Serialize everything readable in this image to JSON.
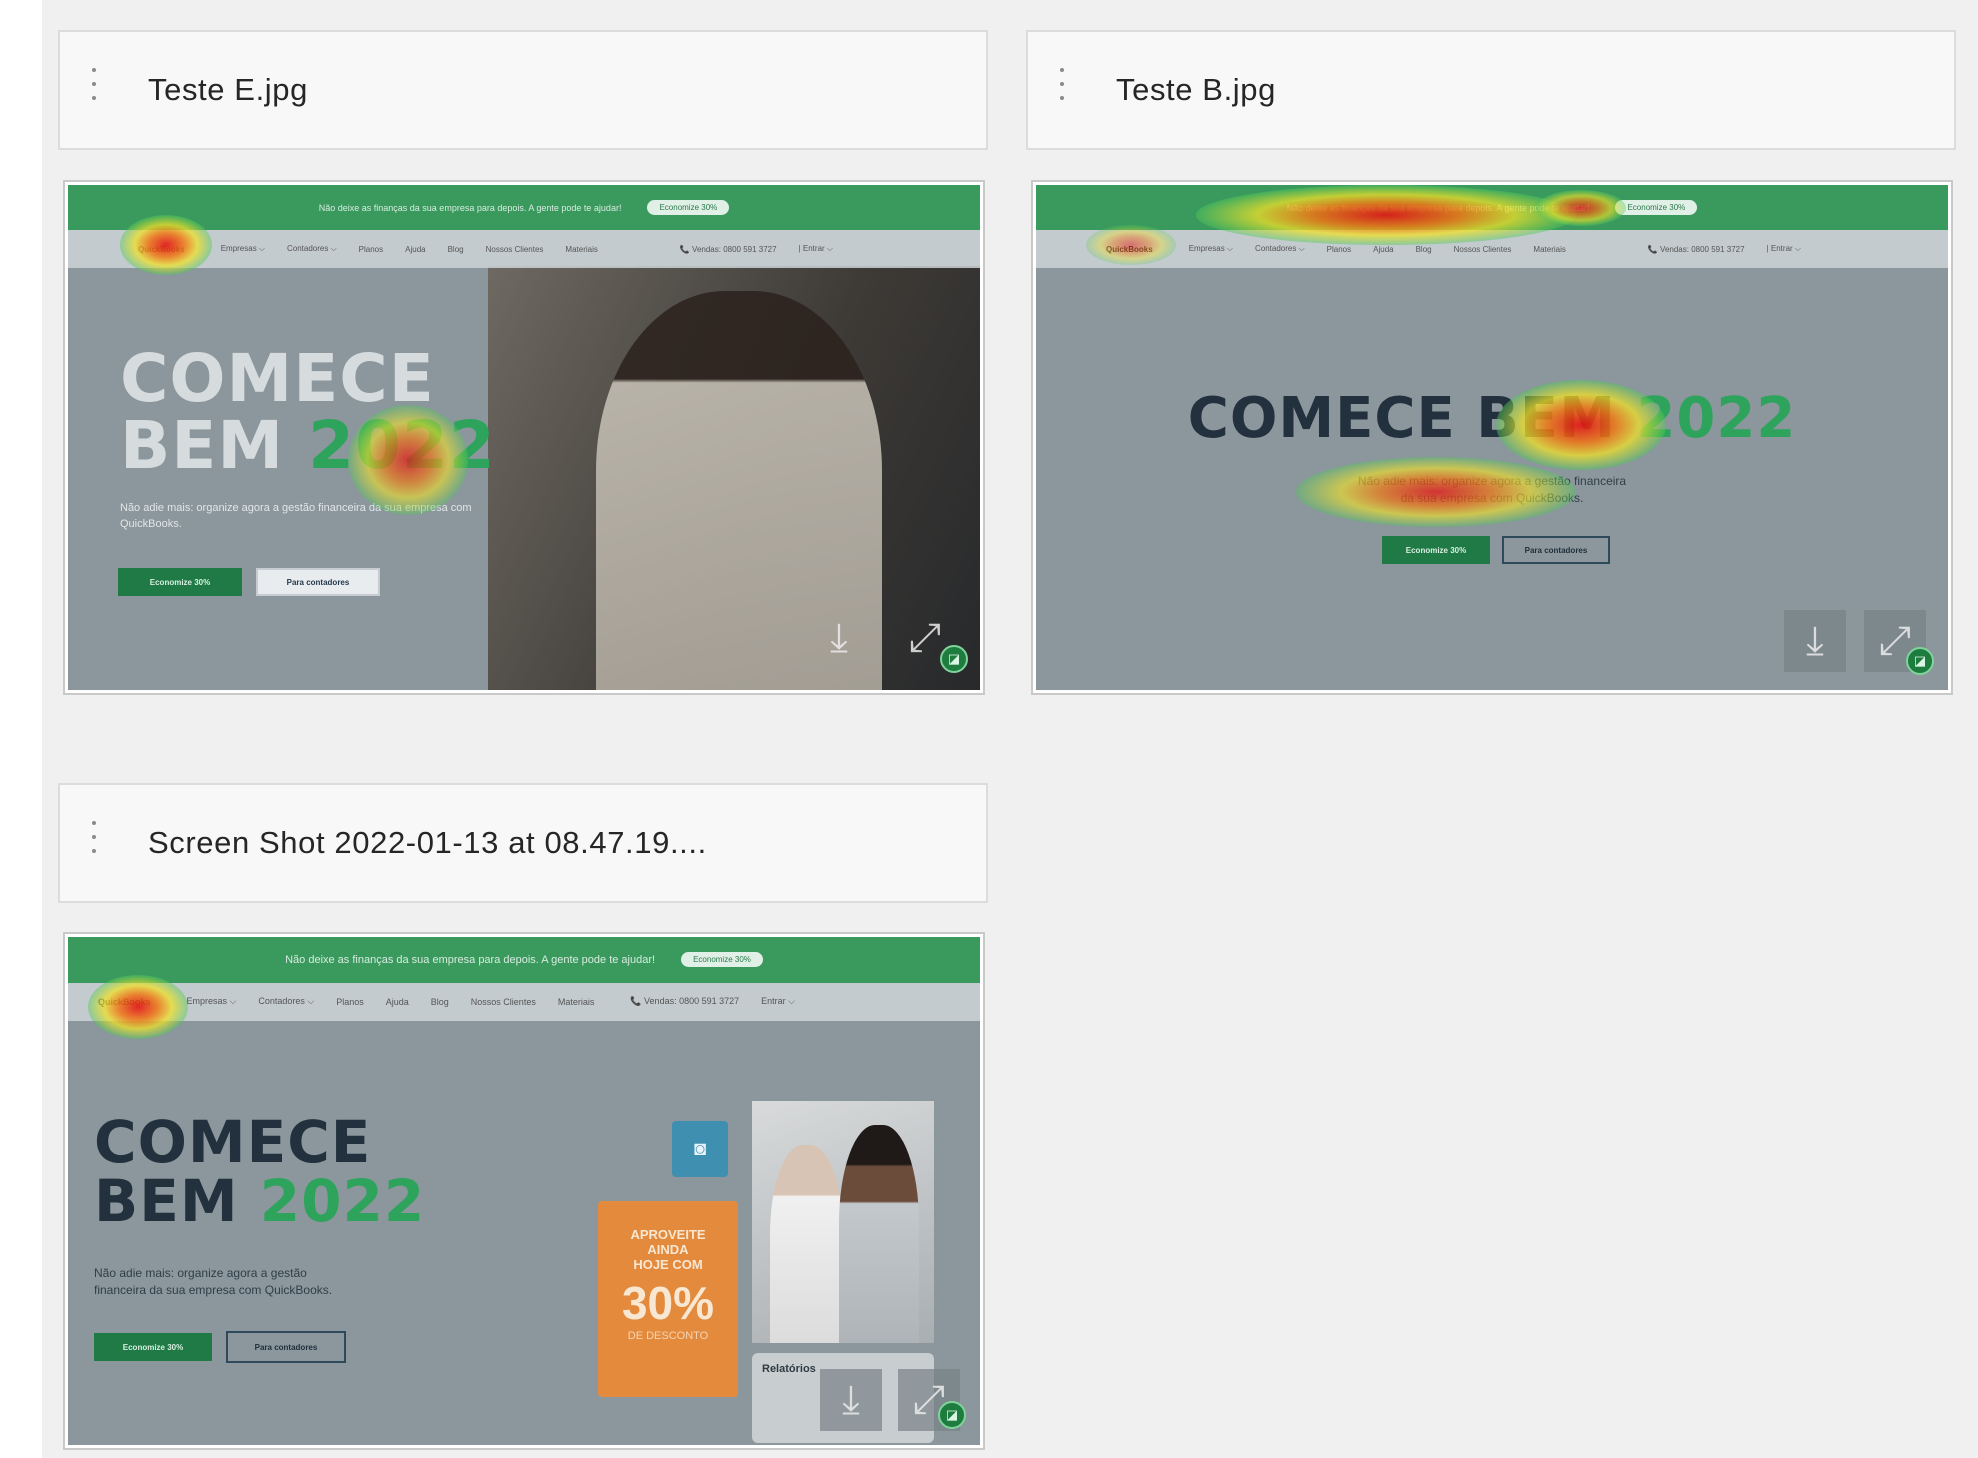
{
  "cards": [
    {
      "title": "Teste E.jpg",
      "screenshot": {
        "banner_text": "Não deixe as finanças da sua empresa para depois. A gente pode te ajudar!",
        "banner_pill": "Economize 30%",
        "nav": [
          "QuickBooks",
          "Empresas ⌵",
          "Contadores ⌵",
          "Planos",
          "Ajuda",
          "Blog",
          "Nossos Clientes",
          "Materiais",
          "📞 Vendas: 0800 591 3727",
          "| Entrar ⌵"
        ],
        "headline_line1": "COMECE",
        "headline_line2_a": "BEM",
        "headline_line2_b": "2022",
        "subtext": "Não adie mais: organize agora a gestão financeira da sua empresa com QuickBooks.",
        "btn_primary": "Economize 30%",
        "btn_secondary": "Para contadores"
      }
    },
    {
      "title": "Teste B.jpg",
      "screenshot": {
        "banner_text": "Não deixe as finanças da sua empresa para depois. A gente pode te ajudar!",
        "banner_pill": "Economize 30%",
        "nav": [
          "QuickBooks",
          "Empresas ⌵",
          "Contadores ⌵",
          "Planos",
          "Ajuda",
          "Blog",
          "Nossos Clientes",
          "Materiais",
          "📞 Vendas: 0800 591 3727",
          "| Entrar ⌵"
        ],
        "headline": "COMECE BEM",
        "headline_year": "2022",
        "subtext_line1": "Não adie mais: organize agora a gestão financeira",
        "subtext_line2": "da sua empresa com QuickBooks.",
        "btn_primary": "Economize 30%",
        "btn_secondary": "Para contadores"
      }
    },
    {
      "title": "Screen Shot 2022-01-13 at 08.47.19....",
      "screenshot": {
        "banner_text": "Não deixe as finanças da sua empresa para depois. A gente pode te ajudar!",
        "banner_pill": "Economize 30%",
        "nav": [
          "QuickBooks",
          "Empresas ⌵",
          "Contadores ⌵",
          "Planos",
          "Ajuda",
          "Blog",
          "Nossos Clientes",
          "Materiais",
          "📞 Vendas: 0800 591 3727",
          "Entrar ⌵"
        ],
        "headline_line1": "COMECE",
        "headline_line2_a": "BEM",
        "headline_line2_b": "2022",
        "subtext_line1": "Não adie mais: organize agora a gestão",
        "subtext_line2": "financeira da sua empresa com QuickBooks.",
        "btn_primary": "Economize 30%",
        "btn_secondary": "Para contadores",
        "promo_line1": "APROVEITE",
        "promo_line2": "AINDA",
        "promo_line3": "HOJE COM",
        "promo_value": "30%",
        "promo_footer": "DE DESCONTO",
        "report_title": "Relatórios"
      }
    }
  ],
  "icons": {
    "menu": "vertical-dots-icon",
    "download": "download-icon",
    "expand": "expand-icon",
    "badge": "eye-tracking-badge-icon",
    "camera": "camera-icon"
  },
  "colors": {
    "brand_green": "#2ea35c",
    "background": "#f0f0f0",
    "promo_orange": "#e48a3c"
  }
}
